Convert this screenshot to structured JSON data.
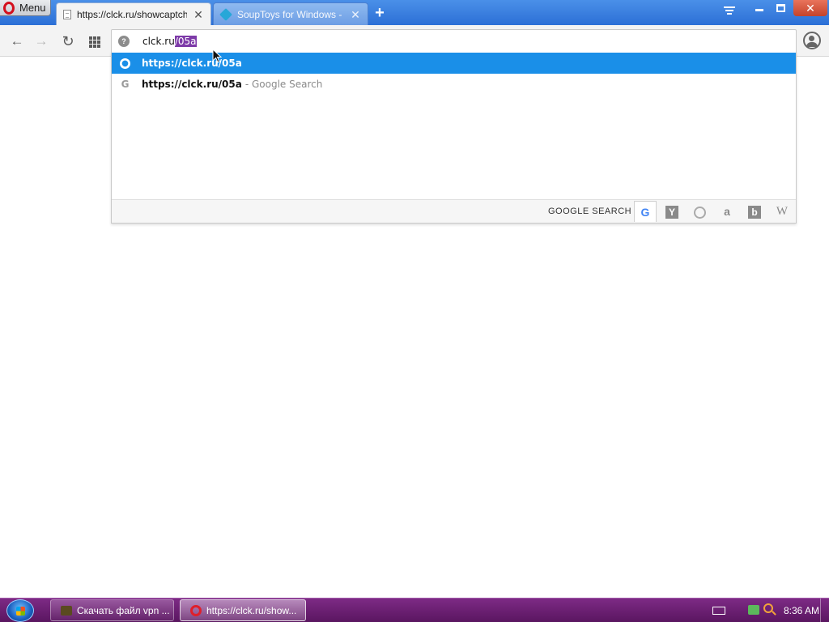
{
  "browser": {
    "menu_label": "Menu",
    "tabs": [
      {
        "title": "https://clck.ru/showcaptcha",
        "icon": "page-icon",
        "active": true
      },
      {
        "title": "SoupToys for Windows - D",
        "icon": "souptoys-icon",
        "active": false
      }
    ],
    "new_tab_label": "+"
  },
  "toolbar": {
    "address_prefix": "clck.ru",
    "address_selected": "/05a"
  },
  "dropdown": {
    "suggestions": [
      {
        "url": "https://clck.ru/05a",
        "suffix": "",
        "icon": "globe-icon",
        "highlighted": true
      },
      {
        "url": "https://clck.ru/05a",
        "suffix": "- Google Search",
        "icon": "google-icon",
        "highlighted": false
      }
    ],
    "search_label": "GOOGLE SEARCH",
    "engines": [
      "google",
      "yandex",
      "duckduckgo",
      "amazon",
      "bing",
      "wikipedia"
    ]
  },
  "taskbar": {
    "items": [
      {
        "label": "Скачать файл vpn ..."
      },
      {
        "label": "https://clck.ru/show..."
      }
    ],
    "clock": "8:36 AM"
  },
  "colors": {
    "tabbar": "#2c6fd6",
    "highlight": "#1a8fe8",
    "selection": "#7d3aa8",
    "taskbar": "#6a1f72"
  }
}
